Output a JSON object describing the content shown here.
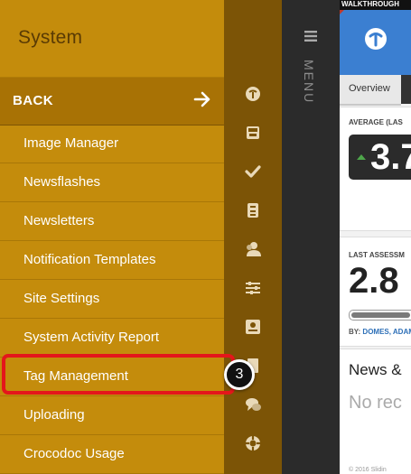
{
  "panel": {
    "title": "System",
    "back_label": "BACK",
    "items": [
      {
        "label": "Image Manager"
      },
      {
        "label": "Newsflashes"
      },
      {
        "label": "Newsletters"
      },
      {
        "label": "Notification Templates"
      },
      {
        "label": "Site Settings"
      },
      {
        "label": "System Activity Report"
      },
      {
        "label": "Tag Management"
      },
      {
        "label": "Uploading"
      },
      {
        "label": "Crocodoc Usage"
      }
    ]
  },
  "rail_icons": [
    "tip-logo-icon",
    "inbox-icon",
    "checkmark-icon",
    "cabinet-icon",
    "users-icon",
    "sliders-icon",
    "id-card-icon",
    "book-icon",
    "chat-icon",
    "lifebuoy-icon"
  ],
  "menu_label": "MENU",
  "dashboard": {
    "walkthrough": "WALKTHROUGH",
    "tab_overview": "Overview",
    "average_label": "AVERAGE (LAS",
    "average_value": "3.7",
    "last_label": "LAST ASSESSM",
    "last_value": "2.8",
    "by_prefix": "BY:",
    "by_names": "DOMES, ADAM",
    "progress": 0.85,
    "news_title": "News &",
    "no_records": "No rec",
    "copyright": "© 2016 Slidin"
  },
  "step_badge": "3",
  "colors": {
    "panel": "#c48c0c",
    "back_bar": "#a87205",
    "rail": "#7c5406",
    "highlight": "#e4161b",
    "blue_header": "#3b7fd1"
  }
}
